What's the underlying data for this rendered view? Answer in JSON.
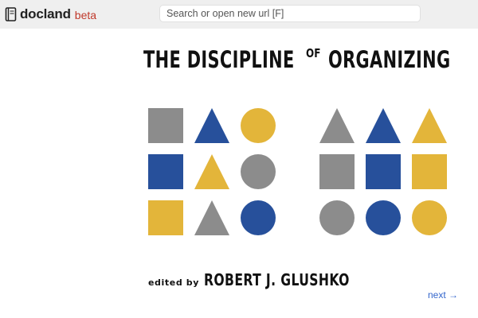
{
  "app": {
    "name": "docland",
    "badge": "beta",
    "icon": "book-icon",
    "badge_color": "#c0392b"
  },
  "search": {
    "placeholder": "Search or open new url [F]",
    "value": ""
  },
  "document": {
    "title_part1": "THE DISCIPLINE",
    "title_connector": "OF",
    "title_part2": "ORGANIZING",
    "editor_prefix": "edited by",
    "editor_name": "ROBERT J. GLUSHKO",
    "shape_colors": {
      "gray": "#8c8c8c",
      "blue": "#27509b",
      "yellow": "#e3b53a"
    },
    "left_grid": [
      [
        "square:gray",
        "triangle:blue",
        "circle:yellow"
      ],
      [
        "square:blue",
        "triangle:yellow",
        "circle:gray"
      ],
      [
        "square:yellow",
        "triangle:gray",
        "circle:blue"
      ]
    ],
    "right_grid": [
      [
        "triangle:gray",
        "triangle:blue",
        "triangle:yellow"
      ],
      [
        "square:gray",
        "square:blue",
        "square:yellow"
      ],
      [
        "circle:gray",
        "circle:blue",
        "circle:yellow"
      ]
    ]
  },
  "nav": {
    "next_label": "next →",
    "link_color": "#3366cc"
  }
}
